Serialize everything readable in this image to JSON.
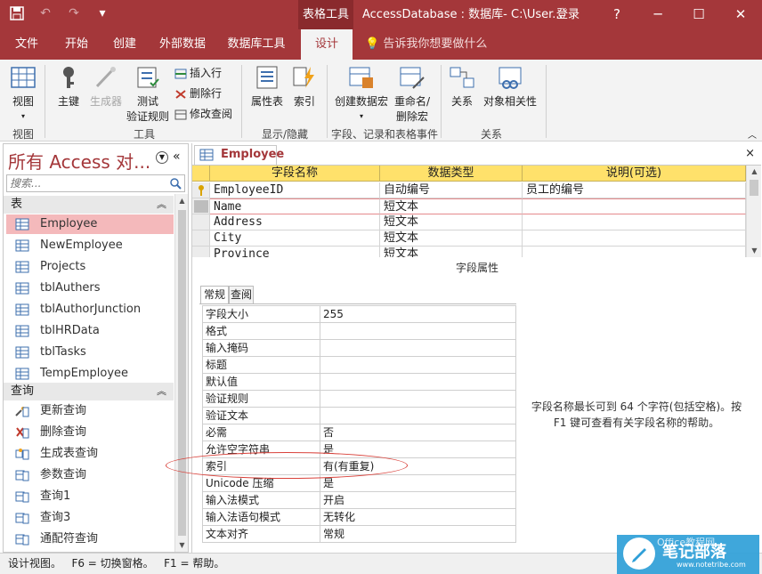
{
  "titlebar": {
    "context_tab": "表格工具",
    "app_title": "AccessDatabase : 数据库- C:\\User...",
    "login": "登录",
    "help": "?",
    "minimize": "─",
    "maximize": "☐",
    "close": "✕"
  },
  "tabs": {
    "file": "文件",
    "home": "开始",
    "create": "创建",
    "external": "外部数据",
    "dbtools": "数据库工具",
    "design": "设计",
    "tell_me": "告诉我你想要做什么"
  },
  "ribbon": {
    "view": "视图",
    "primary_key": "主键",
    "builder": "生成器",
    "test_rules_1": "测试",
    "test_rules_2": "验证规则",
    "insert_rows": "插入行",
    "delete_rows": "删除行",
    "modify_lookups": "修改查阅",
    "property_sheet": "属性表",
    "indexes": "索引",
    "create_macros": "创建数据宏",
    "rename_macro_1": "重命名/",
    "rename_macro_2": "删除宏",
    "relationships": "关系",
    "object_deps": "对象相关性",
    "group_views": "视图",
    "group_tools": "工具",
    "group_showhide": "显示/隐藏",
    "group_events": "字段、记录和表格事件",
    "group_relationships": "关系"
  },
  "nav": {
    "title": "所有 Access 对...",
    "search_placeholder": "搜索...",
    "section_tables": "表",
    "section_queries": "查询",
    "tables": [
      {
        "label": "Employee"
      },
      {
        "label": "NewEmployee"
      },
      {
        "label": "Projects"
      },
      {
        "label": "tblAuthers"
      },
      {
        "label": "tblAuthorJunction"
      },
      {
        "label": "tblHRData"
      },
      {
        "label": "tblTasks"
      },
      {
        "label": "TempEmployee"
      }
    ],
    "queries": [
      {
        "label": "更新查询",
        "icon": "update-query-icon"
      },
      {
        "label": "删除查询",
        "icon": "delete-query-icon"
      },
      {
        "label": "生成表查询",
        "icon": "make-table-query-icon"
      },
      {
        "label": "参数查询",
        "icon": "select-query-icon"
      },
      {
        "label": "查询1",
        "icon": "select-query-icon"
      },
      {
        "label": "查询3",
        "icon": "select-query-icon"
      },
      {
        "label": "通配符查询",
        "icon": "select-query-icon"
      }
    ]
  },
  "doc": {
    "tab_label": "Employee",
    "close": "×",
    "columns": [
      "字段名称",
      "数据类型",
      "说明(可选)"
    ],
    "rows": [
      {
        "name": "EmployeeID",
        "type": "自动编号",
        "desc": "员工的编号"
      },
      {
        "name": "Name",
        "type": "短文本",
        "desc": ""
      },
      {
        "name": "Address",
        "type": "短文本",
        "desc": ""
      },
      {
        "name": "City",
        "type": "短文本",
        "desc": ""
      },
      {
        "name": "Province",
        "type": "短文本",
        "desc": ""
      }
    ],
    "props_title": "字段属性",
    "prop_tabs": [
      "常规",
      "查阅"
    ],
    "properties": [
      {
        "name": "字段大小",
        "value": "255"
      },
      {
        "name": "格式",
        "value": ""
      },
      {
        "name": "输入掩码",
        "value": ""
      },
      {
        "name": "标题",
        "value": ""
      },
      {
        "name": "默认值",
        "value": ""
      },
      {
        "name": "验证规则",
        "value": ""
      },
      {
        "name": "验证文本",
        "value": ""
      },
      {
        "name": "必需",
        "value": "否"
      },
      {
        "name": "允许空字符串",
        "value": "是"
      },
      {
        "name": "索引",
        "value": "有(有重复)"
      },
      {
        "name": "Unicode 压缩",
        "value": "是"
      },
      {
        "name": "输入法模式",
        "value": "开启"
      },
      {
        "name": "输入法语句模式",
        "value": "无转化"
      },
      {
        "name": "文本对齐",
        "value": "常规"
      }
    ],
    "help_text": "字段名称最长可到 64 个字符(包括空格)。按 F1 键可查看有关字段名称的帮助。"
  },
  "status": {
    "text": "设计视图。   F6 = 切换窗格。   F1 = 帮助。"
  },
  "watermark": {
    "cn": "笔记部落",
    "office": "Office教程网",
    "url": "www.notetribe.com"
  },
  "colors": {
    "accent": "#a4373a",
    "header_yellow": "#ffe16b",
    "selected_nav": "#f4b9bb"
  }
}
